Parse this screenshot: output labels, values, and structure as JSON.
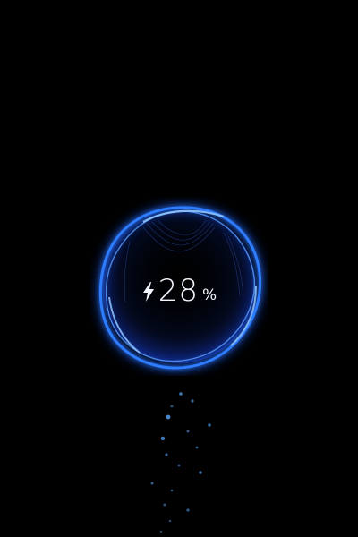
{
  "charging": {
    "battery_level": "28",
    "unit": "%",
    "battery_fraction": 0.28
  },
  "icons": {
    "bolt": "lightning-bolt-icon"
  },
  "colors": {
    "background": "#000000",
    "ring": "#2f7bff",
    "ring_glow": "#1e5bff",
    "ring_highlight": "#8fc4ff",
    "text": "#f2f6ff",
    "particle": "#5aa9ff"
  }
}
